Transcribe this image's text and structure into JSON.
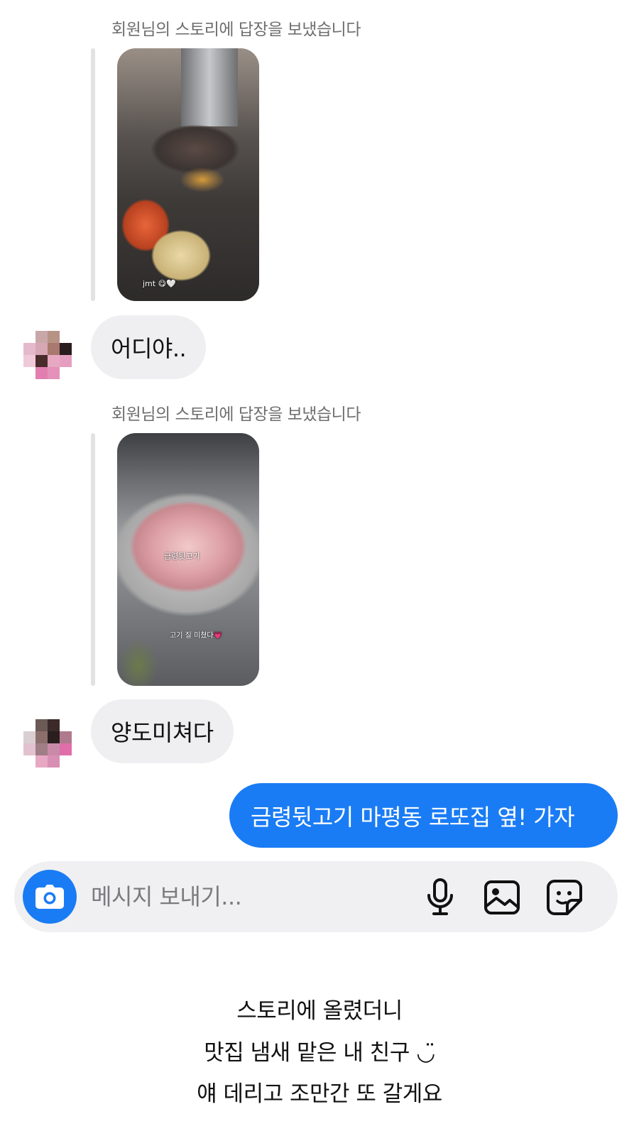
{
  "story_reply_label": "회원님의 스토리에 답장을 보냈습니다",
  "messages": [
    {
      "type": "story_reply",
      "caption": "jmt 😋🤍"
    },
    {
      "type": "incoming",
      "text": "어디야.."
    },
    {
      "type": "story_reply",
      "caption_top": "금령뒷고기",
      "caption_bottom": "고기 질 미쳤다💗"
    },
    {
      "type": "incoming",
      "text": "양도미쳐다"
    },
    {
      "type": "outgoing",
      "text": "금령뒷고기 마평동 로또집 옆! 가자"
    }
  ],
  "composer": {
    "placeholder": "메시지 보내기...",
    "icons": [
      "camera-icon",
      "microphone-icon",
      "gallery-icon",
      "sticker-icon"
    ]
  },
  "colors": {
    "accent": "#1a7cf5",
    "incoming_bubble": "#efeff1",
    "composer_bg": "#f0f0f2",
    "label": "#6e6e6e"
  },
  "caption_lines": [
    "스토리에 올렸더니",
    "맛집 냄새 맡은 내 친구 ◡̈",
    "얘 데리고 조만간 또 갈게요"
  ]
}
